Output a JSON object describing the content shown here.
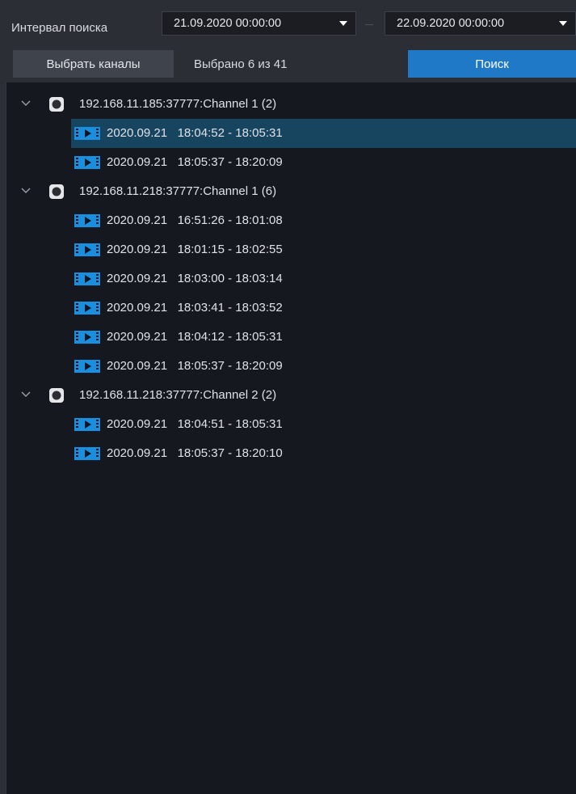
{
  "toolbar": {
    "interval_label": "Интервал поиска",
    "date_from": "21.09.2020 00:00:00",
    "date_to": "22.09.2020 00:00:00",
    "select_channels_label": "Выбрать каналы",
    "selected_info": "Выбрано 6 из 41",
    "search_label": "Поиск"
  },
  "icons": {
    "expand": "chevron-down-icon",
    "camera": "camera-icon",
    "recording": "video-file-icon",
    "dropdown": "caret-down-icon"
  },
  "colors": {
    "accent": "#1f79c6",
    "selection": "#17445f",
    "icon_blue": "#1a8fe0",
    "background": "#161820",
    "toolbar": "#2b2e35"
  },
  "tree": {
    "groups": [
      {
        "label": "192.168.11.185:37777:Channel 1  (2)",
        "items": [
          {
            "label": "2020.09.21   18:04:52 - 18:05:31",
            "selected": true
          },
          {
            "label": "2020.09.21   18:05:37 - 18:20:09",
            "selected": false
          }
        ]
      },
      {
        "label": "192.168.11.218:37777:Channel 1  (6)",
        "items": [
          {
            "label": "2020.09.21   16:51:26 - 18:01:08",
            "selected": false
          },
          {
            "label": "2020.09.21   18:01:15 - 18:02:55",
            "selected": false
          },
          {
            "label": "2020.09.21   18:03:00 - 18:03:14",
            "selected": false
          },
          {
            "label": "2020.09.21   18:03:41 - 18:03:52",
            "selected": false
          },
          {
            "label": "2020.09.21   18:04:12 - 18:05:31",
            "selected": false
          },
          {
            "label": "2020.09.21   18:05:37 - 18:20:09",
            "selected": false
          }
        ]
      },
      {
        "label": "192.168.11.218:37777:Channel 2  (2)",
        "items": [
          {
            "label": "2020.09.21   18:04:51 - 18:05:31",
            "selected": false
          },
          {
            "label": "2020.09.21   18:05:37 - 18:20:10",
            "selected": false
          }
        ]
      }
    ]
  }
}
